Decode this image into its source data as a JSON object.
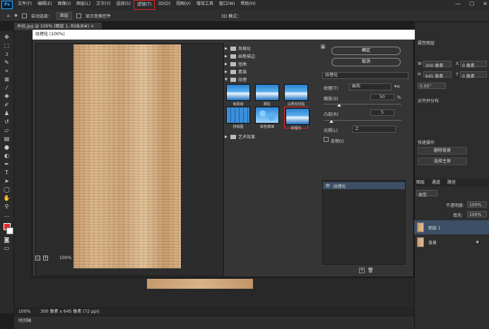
{
  "menu": {
    "logo": "Ps",
    "items": [
      "文件(F)",
      "编辑(E)",
      "图像(I)",
      "图层(L)",
      "文字(Y)",
      "选择(S)",
      "滤镜(T)",
      "3D(D)",
      "视图(V)",
      "增效工具",
      "窗口(W)",
      "帮助(H)"
    ],
    "active_index": 6,
    "window_controls": [
      "—",
      "☐",
      "✕"
    ]
  },
  "options_bar": {
    "auto_select": "自动选择：",
    "auto_select_target": "图层",
    "show_transform": "显示变换控件",
    "mode_3d": "3D 模式："
  },
  "document": {
    "tab_label": "木纹.jpg @ 100% (图层 1, RGB/8#) ×",
    "zoom_status": "100%",
    "doc_info": "300 像素 x 645 像素 (72 ppi)",
    "timeline": "时间轴"
  },
  "dialog": {
    "title": "纹理化 (100%)",
    "preview_zoom": "100%",
    "zoom_minus": "−",
    "zoom_plus": "+",
    "folders_top": [
      "风格化",
      "画笔描边",
      "扭曲",
      "素描",
      "纹理"
    ],
    "thumbs": [
      {
        "label": "龟裂缝",
        "style": "ocean"
      },
      {
        "label": "颗粒",
        "style": "ocean"
      },
      {
        "label": "马赛克拼贴",
        "style": "ocean"
      },
      {
        "label": "拼缀图",
        "style": "tiles"
      },
      {
        "label": "染色玻璃",
        "style": "glass"
      },
      {
        "label": "纹理化",
        "style": "ocean"
      }
    ],
    "selected_thumb_index": 5,
    "folder_bottom": "艺术效果",
    "ok_label": "确定",
    "cancel_label": "取消",
    "filter_select": "纹理化",
    "texture_label": "纹理(T)",
    "texture_value": "画布",
    "scaling_label": "缩放(S)",
    "scaling_value": "50",
    "scaling_unit": "%",
    "scaling_fraction": 0.2,
    "relief_label": "凸现(R)",
    "relief_value": "5",
    "relief_fraction": 0.1,
    "light_label": "光照(L)",
    "light_value": "上",
    "invert_label": "反相(I)",
    "effect_layer": "纹理化",
    "colors": {
      "selection_highlight": "#e02020"
    }
  },
  "right_panel": {
    "panel_title": "属性图层",
    "w_label": "W",
    "w_value": "300 像素",
    "x_label": "X",
    "x_value": "0 像素",
    "h_label": "H",
    "h_value": "645 像素",
    "y_label": "Y",
    "y_value": "0 像素",
    "angle": "0.00°",
    "align_section": "对齐并分布",
    "quick_actions": "快速操作",
    "remove_bg": "删除背景",
    "select_subject": "选择主体",
    "tabs": [
      "图层",
      "通道",
      "路径"
    ],
    "kind": "类型",
    "opacity_label": "不透明度:",
    "opacity_value": "100%",
    "fill_label": "填充:",
    "fill_value": "100%",
    "layers": [
      {
        "name": "图层 1",
        "selected": true
      },
      {
        "name": "背景",
        "selected": false
      }
    ]
  }
}
